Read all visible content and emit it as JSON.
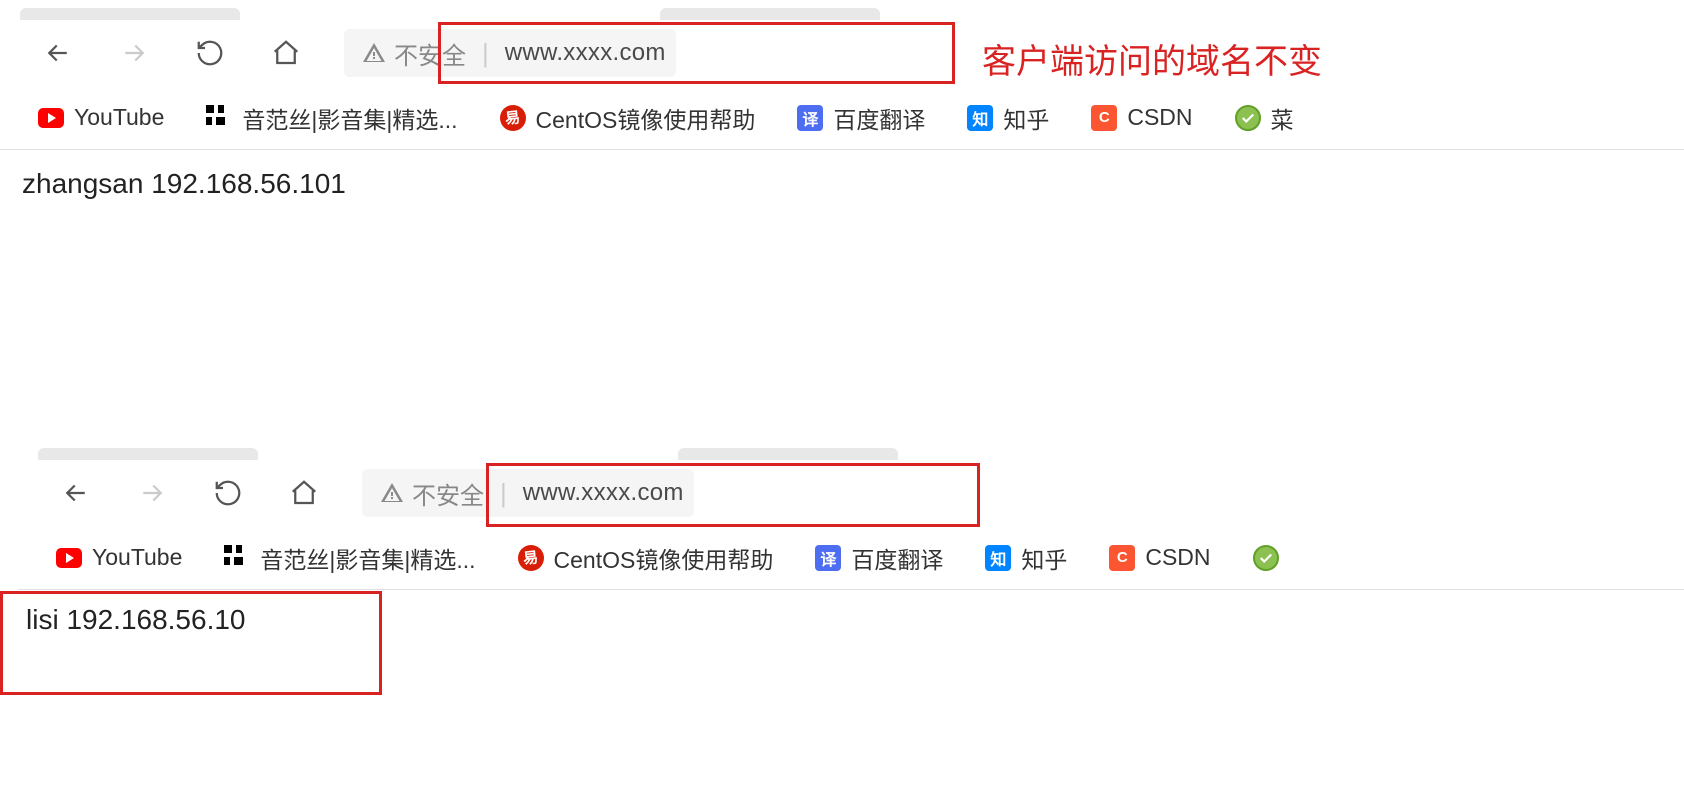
{
  "browser1": {
    "address": {
      "insecure_label": "不安全",
      "url": "www.xxxx.com"
    },
    "bookmarks": [
      {
        "label": "YouTube"
      },
      {
        "label": "音范丝|影音集|精选..."
      },
      {
        "label": "CentOS镜像使用帮助"
      },
      {
        "label": "百度翻译"
      },
      {
        "label": "知乎"
      },
      {
        "label": "CSDN"
      },
      {
        "label": "菜"
      }
    ],
    "page_content": "zhangsan 192.168.56.101",
    "annotation": "客户端访问的域名不变"
  },
  "browser2": {
    "address": {
      "insecure_label": "不安全",
      "url": "www.xxxx.com"
    },
    "bookmarks": [
      {
        "label": "YouTube"
      },
      {
        "label": "音范丝|影音集|精选..."
      },
      {
        "label": "CentOS镜像使用帮助"
      },
      {
        "label": "百度翻译"
      },
      {
        "label": "知乎"
      },
      {
        "label": "CSDN"
      }
    ],
    "page_content": "lisi 192.168.56.10"
  }
}
